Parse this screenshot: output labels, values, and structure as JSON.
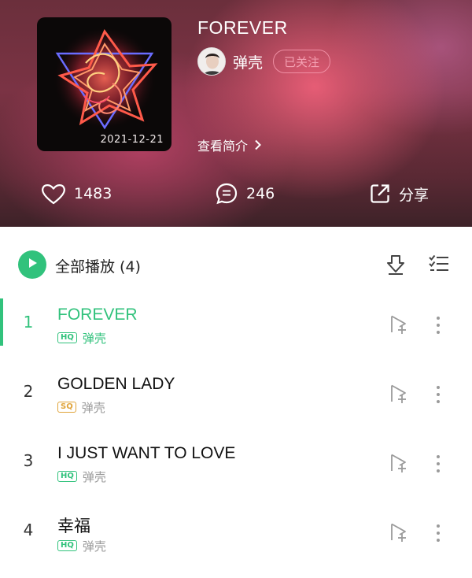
{
  "header": {
    "album_title": "FOREVER",
    "cover_date": "2021-12-21",
    "artist_name": "弹壳",
    "follow_label": "已关注",
    "intro_label": "查看简介",
    "likes": "1483",
    "comments": "246",
    "share_label": "分享"
  },
  "list": {
    "play_all_label": "全部播放 (4)",
    "songs": [
      {
        "index": "1",
        "title": "FOREVER",
        "quality": "HQ",
        "artist": "弹壳",
        "playing": true
      },
      {
        "index": "2",
        "title": "GOLDEN LADY",
        "quality": "SQ",
        "artist": "弹壳",
        "playing": false
      },
      {
        "index": "3",
        "title": "I JUST WANT TO LOVE",
        "quality": "HQ",
        "artist": "弹壳",
        "playing": false
      },
      {
        "index": "4",
        "title": "幸福",
        "quality": "HQ",
        "artist": "弹壳",
        "playing": false
      }
    ]
  },
  "colors": {
    "accent": "#31c27c",
    "sq_badge": "#e0a43a",
    "follow_border": "#f08fa4"
  },
  "icons": [
    "heart-icon",
    "comment-icon",
    "share-icon",
    "play-icon",
    "download-icon",
    "multi-select-icon",
    "add-to-playlist-icon",
    "more-icon",
    "chevron-right-icon"
  ]
}
